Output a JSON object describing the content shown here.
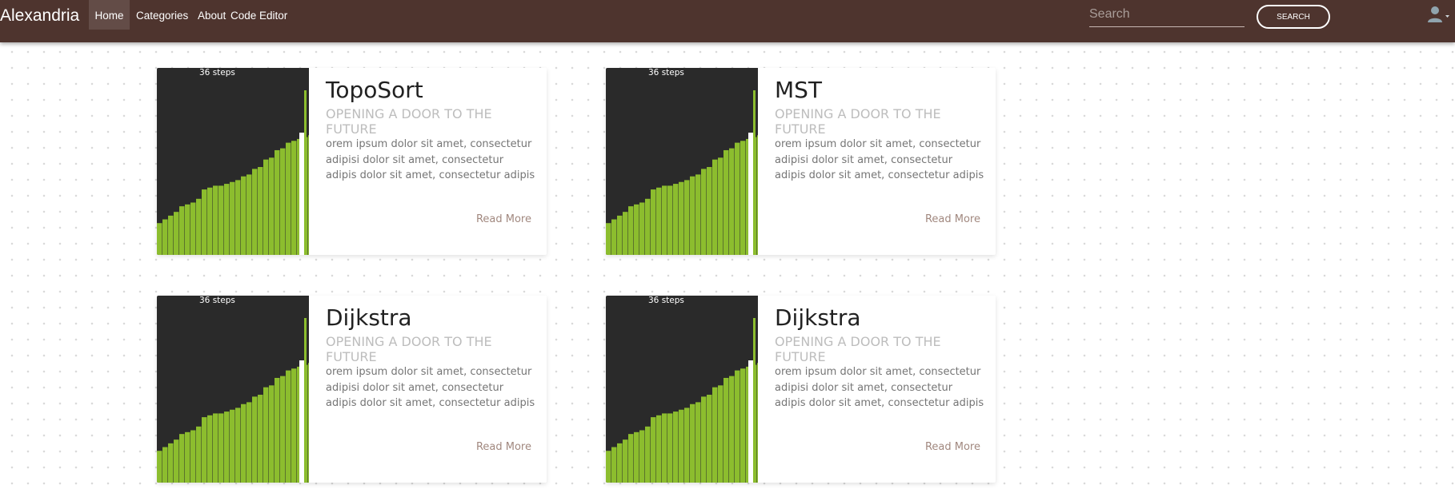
{
  "navbar": {
    "brand": "Alexandria",
    "links": [
      "Home",
      "Categories",
      "About",
      "Code Editor"
    ],
    "active": "Home",
    "search": {
      "placeholder": "Search",
      "value": "",
      "button_label": "SEARCH"
    },
    "user_icon": "user-icon",
    "colors": {
      "background": "#4e342e",
      "text": "#ffffff"
    }
  },
  "cards": [
    {
      "image": {
        "label": "36 steps",
        "bar_values": [
          17,
          19,
          21,
          23,
          26,
          27,
          28,
          30,
          35,
          36,
          37,
          37,
          38,
          39,
          40,
          42,
          43,
          46,
          47,
          51,
          52,
          56,
          57,
          60,
          61,
          62,
          63,
          64
        ],
        "bar_color": "#8cbd2e",
        "background": "#2a2a2a"
      },
      "title": "TopoSort",
      "subtitle": "OPENING A DOOR TO THE FUTURE",
      "text": "orem ipsum dolor sit amet, consectetur adipisi dolor sit amet, consectetur adipis dolor sit amet, consectetur adipis",
      "link": "Read More"
    },
    {
      "image": {
        "label": "36 steps",
        "bar_values": [
          17,
          19,
          21,
          23,
          26,
          27,
          28,
          30,
          35,
          36,
          37,
          37,
          38,
          39,
          40,
          42,
          43,
          46,
          47,
          51,
          52,
          56,
          57,
          60,
          61,
          62,
          63,
          64
        ],
        "bar_color": "#8cbd2e",
        "background": "#2a2a2a"
      },
      "title": "MST",
      "subtitle": "OPENING A DOOR TO THE FUTURE",
      "text": "orem ipsum dolor sit amet, consectetur adipisi dolor sit amet, consectetur adipis dolor sit amet, consectetur adipis",
      "link": "Read More"
    },
    {
      "image": {
        "label": "36 steps",
        "bar_values": [
          17,
          19,
          21,
          23,
          26,
          27,
          28,
          30,
          35,
          36,
          37,
          37,
          38,
          39,
          40,
          42,
          43,
          46,
          47,
          51,
          52,
          56,
          57,
          60,
          61,
          62,
          63,
          64
        ],
        "bar_color": "#8cbd2e",
        "background": "#2a2a2a"
      },
      "title": "Dijkstra",
      "subtitle": "OPENING A DOOR TO THE FUTURE",
      "text": "orem ipsum dolor sit amet, consectetur adipisi dolor sit amet, consectetur adipis dolor sit amet, consectetur adipis",
      "link": "Read More"
    },
    {
      "image": {
        "label": "36 steps",
        "bar_values": [
          17,
          19,
          21,
          23,
          26,
          27,
          28,
          30,
          35,
          36,
          37,
          37,
          38,
          39,
          40,
          42,
          43,
          46,
          47,
          51,
          52,
          56,
          57,
          60,
          61,
          62,
          63,
          64
        ],
        "bar_color": "#8cbd2e",
        "background": "#2a2a2a"
      },
      "title": "Dijkstra",
      "subtitle": "OPENING A DOOR TO THE FUTURE",
      "text": "orem ipsum dolor sit amet, consectetur adipisi dolor sit amet, consectetur adipis dolor sit amet, consectetur adipis",
      "link": "Read More"
    }
  ]
}
